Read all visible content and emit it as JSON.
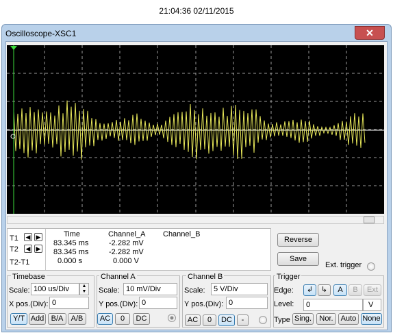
{
  "timestamp": "21:04:36 02/11/2015",
  "window": {
    "title": "Oscilloscope-XSC1",
    "close_glyph": "✕"
  },
  "readout": {
    "headers": {
      "time": "Time",
      "channel_a": "Channel_A",
      "channel_b": "Channel_B"
    },
    "rows": [
      {
        "label": "T1",
        "time": "83.345 ms",
        "channel_a": "-2.282 mV",
        "channel_b": ""
      },
      {
        "label": "T2",
        "time": "83.345 ms",
        "channel_a": "-2.282 mV",
        "channel_b": ""
      },
      {
        "label": "T2-T1",
        "time": "0.000 s",
        "channel_a": "0.000 V",
        "channel_b": ""
      }
    ]
  },
  "buttons": {
    "reverse": "Reverse",
    "save": "Save",
    "ext_trigger": "Ext. trigger"
  },
  "timebase": {
    "title": "Timebase",
    "scale_label": "Scale:",
    "scale_value": "100 us/Div",
    "xpos_label": "X pos.(Div):",
    "xpos_value": "0",
    "modes": [
      "Y/T",
      "Add",
      "B/A",
      "A/B"
    ],
    "selected_mode": "Y/T"
  },
  "channel_a": {
    "title": "Channel A",
    "scale_label": "Scale:",
    "scale_value": "10 mV/Div",
    "ypos_label": "Y pos.(Div):",
    "ypos_value": "0",
    "coupling": [
      "AC",
      "0",
      "DC"
    ],
    "selected": "AC"
  },
  "channel_b": {
    "title": "Channel B",
    "scale_label": "Scale:",
    "scale_value": "5  V/Div",
    "ypos_label": "Y pos.(Div):",
    "ypos_value": "0",
    "coupling": [
      "AC",
      "0",
      "DC",
      "-"
    ],
    "selected": "DC"
  },
  "trigger": {
    "title": "Trigger",
    "edge_label": "Edge:",
    "edge_rising": "↲",
    "edge_falling": "↳",
    "sources": [
      "A",
      "B",
      "Ext"
    ],
    "selected_source": "A",
    "level_label": "Level:",
    "level_value": "0",
    "level_unit": "V",
    "type_label": "Type",
    "types": [
      "Sing.",
      "Nor.",
      "Auto",
      "None"
    ],
    "selected_type": "None"
  },
  "colors": {
    "trace": "#e8e85a",
    "grid": "#9a9a9a",
    "baseline": "#ffffff",
    "cursor": "#3cdc3c"
  }
}
